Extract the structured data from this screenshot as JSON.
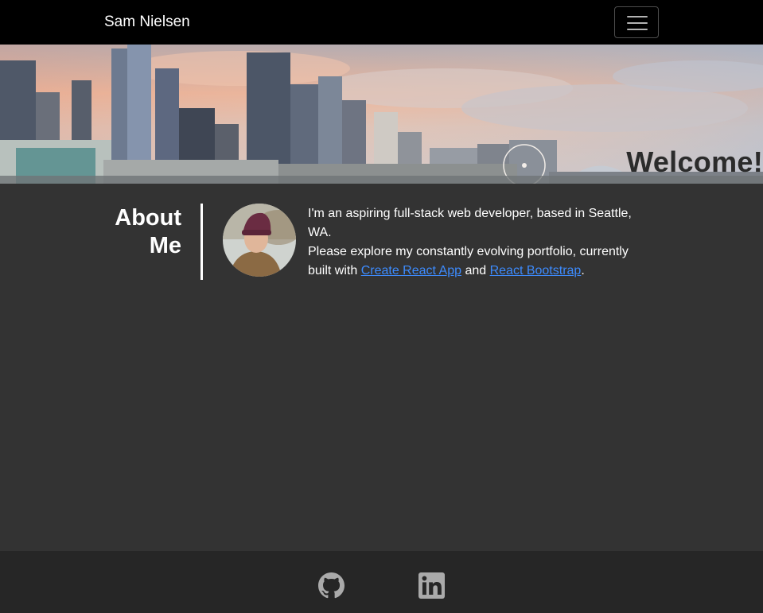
{
  "navbar": {
    "brand": "Sam Nielsen",
    "toggler_icon": "hamburger-menu-icon"
  },
  "hero": {
    "image": "seattle-skyline-photo",
    "welcome_text": "Welcome!"
  },
  "about": {
    "title": "About Me",
    "avatar": "profile-photo-avatar",
    "line1": "I'm an aspiring full-stack web developer, based in Seattle, WA.",
    "line2_prefix": "Please explore my constantly evolving portfolio, currently built with ",
    "link1": "Create React App",
    "conjunction": " and ",
    "link2": "React Bootstrap",
    "line2_suffix": "."
  },
  "footer": {
    "icons": [
      "github-icon",
      "linkedin-icon"
    ]
  },
  "colors": {
    "navbar_bg": "#000000",
    "page_bg": "#333333",
    "footer_bg": "#262626",
    "link": "#3d8bfd",
    "icon_gray": "#aaaaaa"
  }
}
